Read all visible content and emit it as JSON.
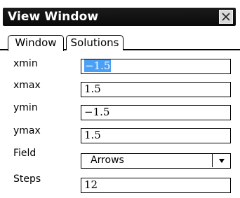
{
  "dialog": {
    "title": "View Window",
    "close_icon": "close-icon"
  },
  "tabs": [
    {
      "label": "Window",
      "active": true
    },
    {
      "label": "Solutions",
      "active": false
    }
  ],
  "fields": {
    "xmin": {
      "label": "xmin",
      "value": "−1.5",
      "selected": true
    },
    "xmax": {
      "label": "xmax",
      "value": "1.5"
    },
    "ymin": {
      "label": "ymin",
      "value": "−1.5"
    },
    "ymax": {
      "label": "ymax",
      "value": "1.5"
    },
    "field": {
      "label": "Field",
      "value": "Arrows",
      "icon": "chevron-down-icon"
    },
    "steps": {
      "label": "Steps",
      "value": "12"
    }
  },
  "colors": {
    "titlebar": "#111111",
    "selection": "#4aa0f5"
  }
}
